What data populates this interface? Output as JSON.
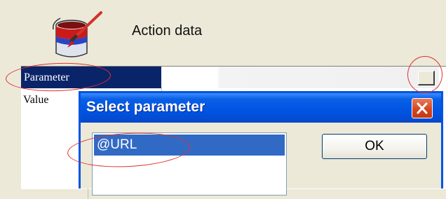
{
  "header": {
    "title": "Action data",
    "icon": "paint-can-icon"
  },
  "grid": {
    "rows": [
      {
        "label": "Parameter",
        "value": ""
      },
      {
        "label": "Value",
        "value": ""
      }
    ],
    "ellipsis_icon": "ellipsis-button"
  },
  "dialog": {
    "title": "Select parameter",
    "close_icon": "close-icon",
    "list_items": [
      "@URL"
    ],
    "ok_label": "OK"
  },
  "colors": {
    "selection": "#0a246a",
    "dialog_title_bar": "#0054e3",
    "list_selection": "#316ac5",
    "annotation": "#e03030"
  }
}
